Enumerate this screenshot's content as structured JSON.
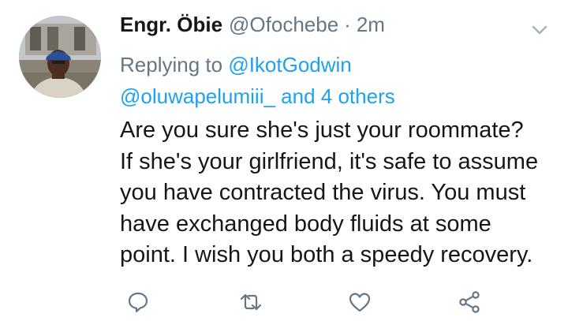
{
  "tweet": {
    "author": {
      "display_name": "Engr. Öbie",
      "handle": "@Ofochebe",
      "time_separator": "·",
      "time": "2m"
    },
    "reply_to": {
      "prefix": "Replying to",
      "first_mention": "@IkotGodwin",
      "second_mention": "@oluwapelumiii_",
      "and_others": "and 4 others"
    },
    "text_lines": [
      "Are you sure she's just your roommate?",
      "If she's your girlfriend, it's safe to assume",
      "you have contracted the virus. You must",
      "have exchanged body fluids at some",
      "point. I wish you both a speedy recovery."
    ]
  },
  "icons": {
    "menu": "chevron-down-icon",
    "reply": "reply-bubble-icon",
    "retweet": "retweet-icon",
    "like": "heart-icon",
    "share": "share-icon"
  },
  "colors": {
    "name": "#14171a",
    "secondary": "#657786",
    "link": "#1da1f2",
    "icon": "#657786",
    "background": "#ffffff"
  }
}
